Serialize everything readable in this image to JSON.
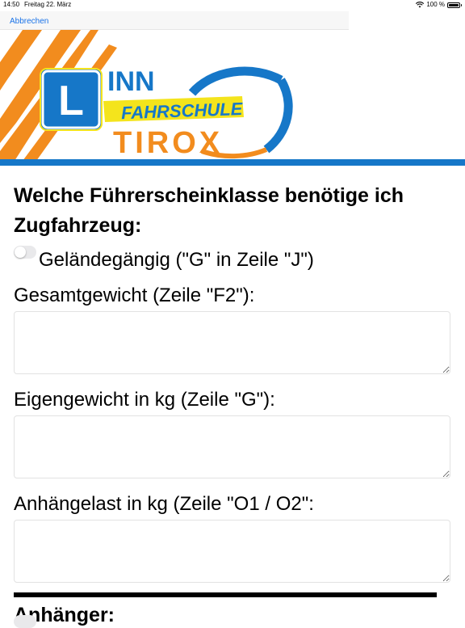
{
  "status_bar": {
    "time": "14:50",
    "date": "Freitag 22. März",
    "battery": "100 %"
  },
  "nav": {
    "cancel_label": "Abbrechen"
  },
  "banner": {
    "logo_letter": "L",
    "logo_inn": "INN",
    "logo_fahrschule": "FAHRSCHULE",
    "logo_tirox": "TIROX",
    "colors": {
      "orange": "#f28c1e",
      "blue": "#1677c8",
      "yellow": "#f4e41c"
    }
  },
  "form": {
    "question": "Welche Führerscheinklasse benötige ich",
    "section_vehicle": "Zugfahrzeug:",
    "toggle_offroad_label": "Geländegängig (\"G\" in Zeile \"J\")",
    "toggle_offroad_value": false,
    "field_total_weight_label": "Gesamtgewicht (Zeile \"F2\"):",
    "field_total_weight_value": "",
    "field_own_weight_label": "Eigengewicht in kg (Zeile \"G\"):",
    "field_own_weight_value": "",
    "field_trailer_load_label": "Anhängelast in kg (Zeile \"O1 / O2\":",
    "field_trailer_load_value": "",
    "section_trailer": "Anhänger:"
  }
}
